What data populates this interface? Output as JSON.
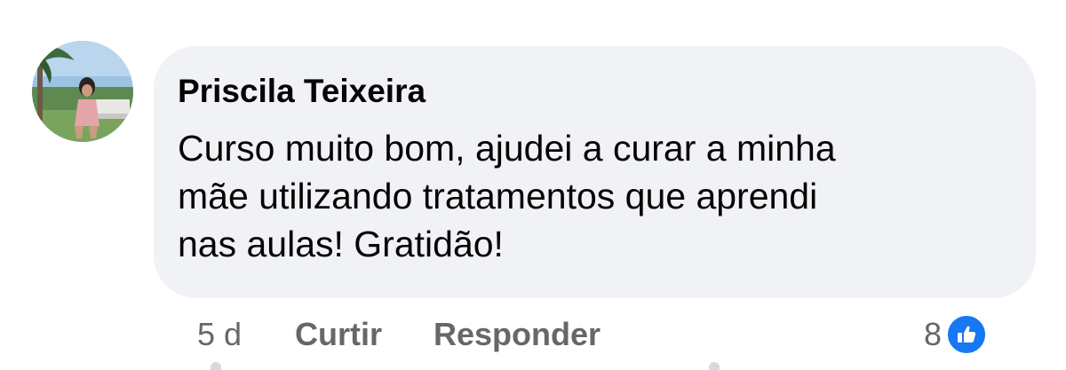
{
  "comment": {
    "author": "Priscila Teixeira",
    "text_lines": [
      "Curso muito bom, ajudei a curar a minha",
      "mãe utilizando tratamentos que aprendi",
      "nas aulas! Gratidão!"
    ],
    "time": "5 d",
    "like_label": "Curtir",
    "reply_label": "Responder",
    "reaction_count": "8",
    "reaction_icon": "thumbs-up-icon"
  },
  "colors": {
    "bubble": "#f0f2f5",
    "text": "#050505",
    "meta": "#65676b",
    "like_blue": "#1877f2"
  }
}
